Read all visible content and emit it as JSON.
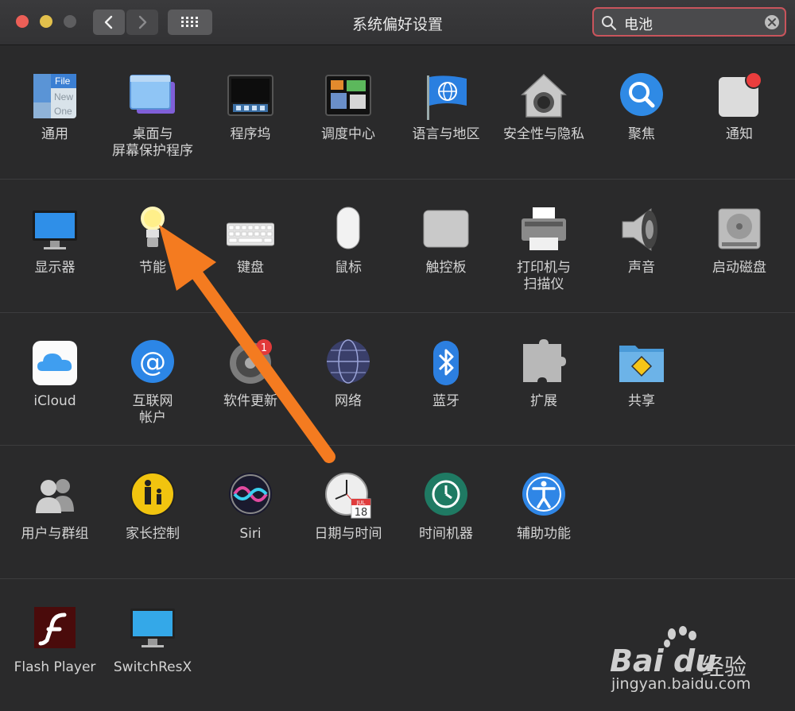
{
  "window": {
    "title": "系统偏好设置",
    "search": {
      "value": "电池"
    },
    "traffic_lights": {
      "close": "#ec5f57",
      "minimize": "#e2c04c",
      "zoom": "#5e5e60"
    }
  },
  "rows": [
    [
      {
        "icon": "general-icon",
        "label": "通用"
      },
      {
        "icon": "desktop-screensaver-icon",
        "label": "桌面与\n屏幕保护程序"
      },
      {
        "icon": "dock-icon",
        "label": "程序坞"
      },
      {
        "icon": "mission-control-icon",
        "label": "调度中心"
      },
      {
        "icon": "language-region-icon",
        "label": "语言与地区"
      },
      {
        "icon": "security-privacy-icon",
        "label": "安全性与隐私"
      },
      {
        "icon": "spotlight-icon",
        "label": "聚焦"
      },
      {
        "icon": "notifications-icon",
        "label": "通知"
      }
    ],
    [
      {
        "icon": "displays-icon",
        "label": "显示器"
      },
      {
        "icon": "energy-saver-icon",
        "label": "节能"
      },
      {
        "icon": "keyboard-icon",
        "label": "键盘"
      },
      {
        "icon": "mouse-icon",
        "label": "鼠标"
      },
      {
        "icon": "trackpad-icon",
        "label": "触控板"
      },
      {
        "icon": "printers-scanners-icon",
        "label": "打印机与\n扫描仪"
      },
      {
        "icon": "sound-icon",
        "label": "声音"
      },
      {
        "icon": "startup-disk-icon",
        "label": "启动磁盘"
      }
    ],
    [
      {
        "icon": "icloud-icon",
        "label": "iCloud"
      },
      {
        "icon": "internet-accounts-icon",
        "label": "互联网\n帐户"
      },
      {
        "icon": "software-update-icon",
        "label": "软件更新",
        "badge": "1"
      },
      {
        "icon": "network-icon",
        "label": "网络"
      },
      {
        "icon": "bluetooth-icon",
        "label": "蓝牙"
      },
      {
        "icon": "extensions-icon",
        "label": "扩展"
      },
      {
        "icon": "sharing-icon",
        "label": "共享"
      }
    ],
    [
      {
        "icon": "users-groups-icon",
        "label": "用户与群组"
      },
      {
        "icon": "parental-controls-icon",
        "label": "家长控制"
      },
      {
        "icon": "siri-icon",
        "label": "Siri"
      },
      {
        "icon": "date-time-icon",
        "label": "日期与时间"
      },
      {
        "icon": "time-machine-icon",
        "label": "时间机器"
      },
      {
        "icon": "accessibility-icon",
        "label": "辅助功能"
      }
    ],
    [
      {
        "icon": "flash-player-icon",
        "label": "Flash Player"
      },
      {
        "icon": "switchresx-icon",
        "label": "SwitchResX"
      }
    ]
  ],
  "icon_text": {
    "general": "File",
    "general2": "New",
    "general3": "One",
    "calendar_month": "JUL",
    "calendar_day": "18"
  },
  "watermark": {
    "brand": "Bai",
    "brand2": "du",
    "suffix": "经验",
    "url": "jingyan.baidu.com"
  },
  "annotation": {
    "arrow_color": "#f47b20"
  }
}
